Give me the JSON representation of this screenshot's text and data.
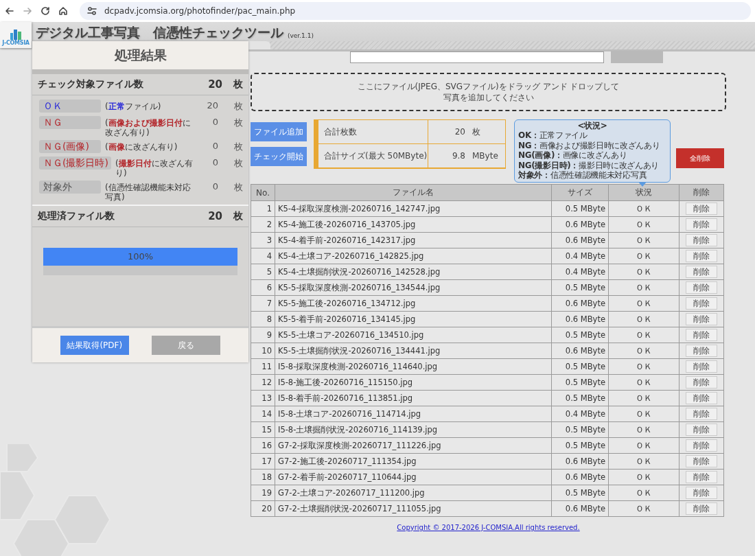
{
  "browser": {
    "url": "dcpadv.jcomsia.org/photofinder/pac_main.php"
  },
  "header": {
    "logo_text": "J-COMSIA",
    "title": "デジタル工事写真　信憑性チェックツール",
    "version": "(ver.1.1)"
  },
  "modal": {
    "title": "処理結果",
    "total": {
      "label": "チェック対象ファイル数",
      "count": "20",
      "unit": "枚"
    },
    "categories": [
      {
        "label": "ＯＫ",
        "note": "(**正常**ファイル)",
        "count": "20",
        "unit": "枚",
        "color": "#2a2ad8"
      },
      {
        "label": "ＮＧ",
        "note": "(**画像および撮影日付**に改ざん有り)",
        "count": "0",
        "unit": "枚",
        "color": "#b3262b"
      },
      {
        "label": "ＮＧ(画像)",
        "note": "(**画像**に改ざん有り)",
        "count": "0",
        "unit": "枚",
        "color": "#b3262b"
      },
      {
        "label": "ＮＧ(撮影日時)",
        "note": "(**撮影日付**に改ざん有り)",
        "count": "0",
        "unit": "枚",
        "color": "#b3262b"
      },
      {
        "label": "対象外",
        "note": "(信憑性確認機能未対応写真)",
        "count": "0",
        "unit": "枚",
        "color": "#555555"
      }
    ],
    "processed": {
      "label": "処理済ファイル数",
      "count": "20",
      "unit": "枚"
    },
    "progress": {
      "level": 1,
      "text": "100%"
    },
    "buttons": [
      {
        "label": "結果取得(PDF)",
        "kind": "primary"
      },
      {
        "label": "戻る",
        "kind": "secondary"
      }
    ]
  },
  "drop_zone": {
    "lines": [
      "ここにファイル(JPEG、SVGファイル)をドラッグ アンド ドロップして",
      "写真を追加してください"
    ]
  },
  "actions": [
    {
      "label": "ファイル追加"
    },
    {
      "label": "チェック開始"
    }
  ],
  "summary": [
    {
      "label": "合計枚数",
      "value": "20",
      "unit": "枚"
    },
    {
      "label": "合計サイズ(最大 50MByte)",
      "value": "9.8",
      "unit": "MByte"
    }
  ],
  "legend": {
    "title": "<状況>",
    "items": [
      {
        "term": "OK：",
        "desc": "正常ファイル"
      },
      {
        "term": "NG：",
        "desc": "画像および撮影日時に改ざんあり"
      },
      {
        "term": "NG(画像)：",
        "desc": "画像に改ざんあり"
      },
      {
        "term": "NG(撮影日時)：",
        "desc": "撮影日時に改ざんあり"
      },
      {
        "term": "対象外：",
        "desc": "信憑性確認機能未対応写真"
      }
    ]
  },
  "delete_all": {
    "label": "全削除"
  },
  "table": {
    "columns": [
      "No.",
      "ファイル名",
      "サイズ",
      "状況",
      "削除"
    ],
    "rows": [
      {
        "no": "1",
        "name": "K5-4-採取深度検測-20260716_142747.jpg",
        "size": "0.5 MByte",
        "status": "ＯＫ",
        "action": "削除"
      },
      {
        "no": "2",
        "name": "K5-4-施工後-20260716_143705.jpg",
        "size": "0.6 MByte",
        "status": "ＯＫ",
        "action": "削除"
      },
      {
        "no": "3",
        "name": "K5-4-着手前-20260716_142317.jpg",
        "size": "0.6 MByte",
        "status": "ＯＫ",
        "action": "削除"
      },
      {
        "no": "4",
        "name": "K5-4-土壌コア-20260716_142825.jpg",
        "size": "0.4 MByte",
        "status": "ＯＫ",
        "action": "削除"
      },
      {
        "no": "5",
        "name": "K5-4-土壌掘削状況-20260716_142528.jpg",
        "size": "0.4 MByte",
        "status": "ＯＫ",
        "action": "削除"
      },
      {
        "no": "6",
        "name": "K5-5-採取深度検測-20260716_134544.jpg",
        "size": "0.5 MByte",
        "status": "ＯＫ",
        "action": "削除"
      },
      {
        "no": "7",
        "name": "K5-5-施工後-20260716_134712.jpg",
        "size": "0.6 MByte",
        "status": "ＯＫ",
        "action": "削除"
      },
      {
        "no": "8",
        "name": "K5-5-着手前-20260716_134145.jpg",
        "size": "0.6 MByte",
        "status": "ＯＫ",
        "action": "削除"
      },
      {
        "no": "9",
        "name": "K5-5-土壌コア-20260716_134510.jpg",
        "size": "0.5 MByte",
        "status": "ＯＫ",
        "action": "削除"
      },
      {
        "no": "10",
        "name": "K5-5-土壌掘削状況-20260716_134441.jpg",
        "size": "0.6 MByte",
        "status": "ＯＫ",
        "action": "削除"
      },
      {
        "no": "11",
        "name": "I5-8-採取深度検測-20260716_114640.jpg",
        "size": "0.5 MByte",
        "status": "ＯＫ",
        "action": "削除"
      },
      {
        "no": "12",
        "name": "I5-8-施工後-20260716_115150.jpg",
        "size": "0.5 MByte",
        "status": "ＯＫ",
        "action": "削除"
      },
      {
        "no": "13",
        "name": "I5-8-着手前-20260716_113851.jpg",
        "size": "0.5 MByte",
        "status": "ＯＫ",
        "action": "削除"
      },
      {
        "no": "14",
        "name": "I5-8-土壌コア-20260716_114714.jpg",
        "size": "0.4 MByte",
        "status": "ＯＫ",
        "action": "削除"
      },
      {
        "no": "15",
        "name": "I5-8-土壌掘削状況-20260716_114139.jpg",
        "size": "0.5 MByte",
        "status": "ＯＫ",
        "action": "削除"
      },
      {
        "no": "16",
        "name": "G7-2-採取深度検測-20260717_111226.jpg",
        "size": "0.5 MByte",
        "status": "ＯＫ",
        "action": "削除"
      },
      {
        "no": "17",
        "name": "G7-2-施工後-20260717_111354.jpg",
        "size": "0.6 MByte",
        "status": "ＯＫ",
        "action": "削除"
      },
      {
        "no": "18",
        "name": "G7-2-着手前-20260717_110644.jpg",
        "size": "0.6 MByte",
        "status": "ＯＫ",
        "action": "削除"
      },
      {
        "no": "19",
        "name": "G7-2-土壌コア-20260717_111200.jpg",
        "size": "0.5 MByte",
        "status": "ＯＫ",
        "action": "削除"
      },
      {
        "no": "20",
        "name": "G7-2-土壌掘削状況-20260717_111055.jpg",
        "size": "0.6 MByte",
        "status": "ＯＫ",
        "action": "削除"
      }
    ]
  },
  "footer": {
    "copyright": "Copyright © 2017-2026 J-COMSIA.All rights reserved."
  }
}
